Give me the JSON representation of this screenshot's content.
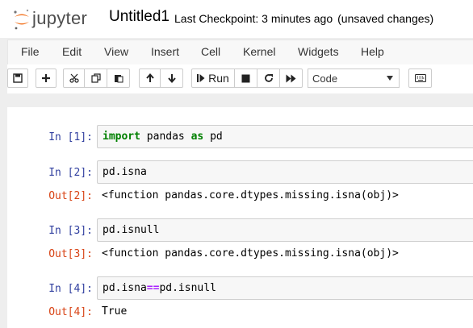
{
  "header": {
    "logo_text": "jupyter",
    "notebook_name": "Untitled1",
    "checkpoint": "Last Checkpoint: 3 minutes ago",
    "status": "(unsaved changes)"
  },
  "menu": [
    "File",
    "Edit",
    "View",
    "Insert",
    "Cell",
    "Kernel",
    "Widgets",
    "Help"
  ],
  "toolbar": {
    "run_label": "Run",
    "cell_type": "Code",
    "icons": [
      "save-icon",
      "plus-icon",
      "cut-icon",
      "copy-icon",
      "paste-icon",
      "arrow-up-icon",
      "arrow-down-icon",
      "step-forward-icon",
      "stop-icon",
      "refresh-icon",
      "fast-forward-icon",
      "keyboard-icon"
    ]
  },
  "cells": [
    {
      "in": "In  [1]:",
      "code": [
        [
          "kw",
          "import"
        ],
        [
          "",
          " pandas "
        ],
        [
          "kw",
          "as"
        ],
        [
          "",
          " pd"
        ]
      ]
    },
    {
      "in": "In  [2]:",
      "code": [
        [
          "",
          "pd.isna"
        ]
      ],
      "out": "Out[2]:",
      "result": "<function pandas.core.dtypes.missing.isna(obj)>"
    },
    {
      "in": "In  [3]:",
      "code": [
        [
          "",
          "pd.isnull"
        ]
      ],
      "out": "Out[3]:",
      "result": "<function pandas.core.dtypes.missing.isna(obj)>"
    },
    {
      "in": "In  [4]:",
      "code": [
        [
          "",
          "pd.isna"
        ],
        [
          "op",
          "=="
        ],
        [
          "",
          "pd.isnull"
        ]
      ],
      "out": "Out[4]:",
      "result": "True"
    }
  ],
  "colors": {
    "background": "#eeeeee",
    "in_prompt": "#303f9f",
    "out_prompt": "#d84315",
    "keyword": "#008000",
    "operator": "#aa22ff",
    "logo_orange": "#f37726"
  }
}
